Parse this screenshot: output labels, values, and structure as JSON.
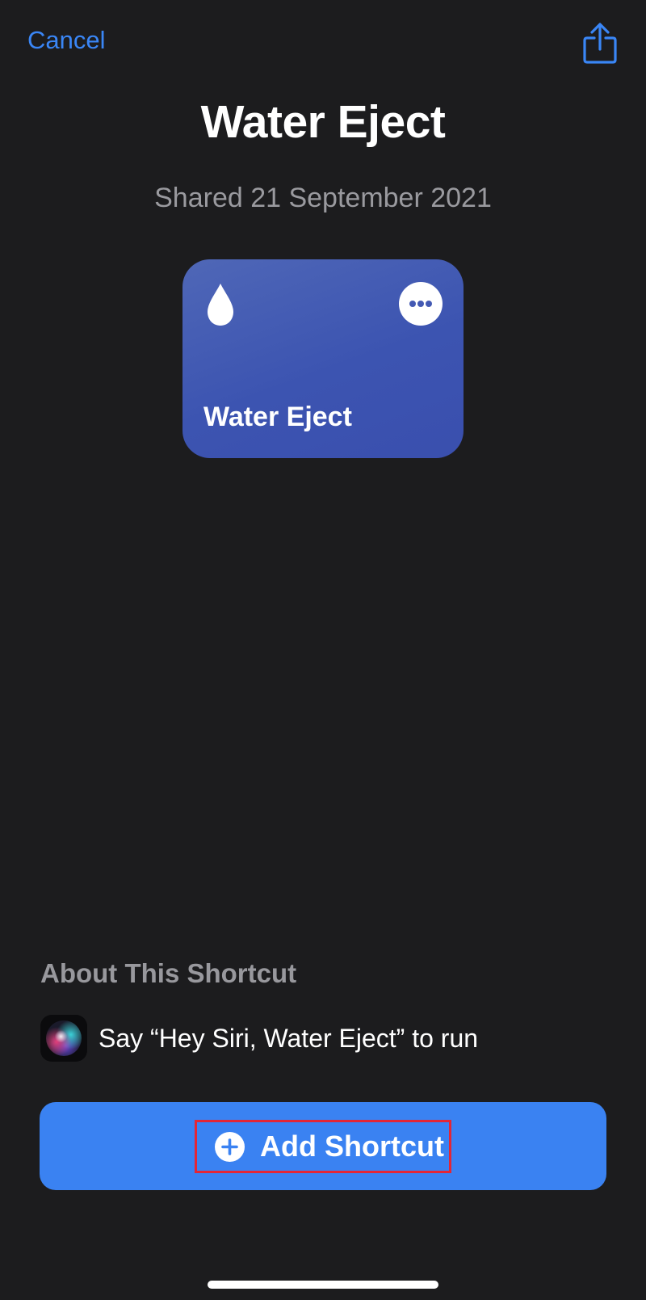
{
  "nav": {
    "cancel_label": "Cancel",
    "share_icon": "share-icon"
  },
  "header": {
    "title": "Water Eject",
    "subtitle": "Shared 21 September 2021"
  },
  "card": {
    "label": "Water Eject",
    "icon": "water-drop-icon",
    "menu_icon": "more-icon",
    "color": "#4359b3"
  },
  "about": {
    "heading": "About This Shortcut",
    "siri_text": "Say “Hey Siri, Water Eject” to run",
    "siri_icon": "siri-icon"
  },
  "actions": {
    "add_label": "Add Shortcut",
    "add_icon": "plus-circle-icon",
    "accent_color": "#3a82f2",
    "highlight_color": "#e32636"
  }
}
